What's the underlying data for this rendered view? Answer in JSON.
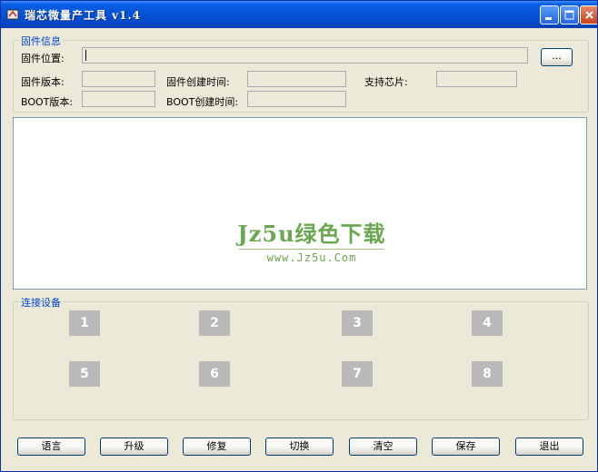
{
  "window": {
    "title": "瑞芯微量产工具 v1.4"
  },
  "firmware": {
    "group_title": "固件信息",
    "location_label": "固件位置:",
    "location_value": "",
    "browse_label": "...",
    "version_label": "固件版本:",
    "version_value": "",
    "create_time_label": "固件创建时间:",
    "create_time_value": "",
    "chip_label": "支持芯片:",
    "chip_value": "",
    "boot_version_label": "BOOT版本:",
    "boot_version_value": "",
    "boot_create_time_label": "BOOT创建时间:",
    "boot_create_time_value": ""
  },
  "log": {
    "watermark_main": "Jz5u绿色下载",
    "watermark_sub": "www.Jz5u.Com"
  },
  "devices": {
    "group_title": "连接设备",
    "slots": [
      "1",
      "2",
      "3",
      "4",
      "5",
      "6",
      "7",
      "8"
    ]
  },
  "actions": {
    "language": "语言",
    "upgrade": "升级",
    "repair": "修复",
    "switch": "切换",
    "clear": "清空",
    "save": "保存",
    "exit": "退出"
  }
}
